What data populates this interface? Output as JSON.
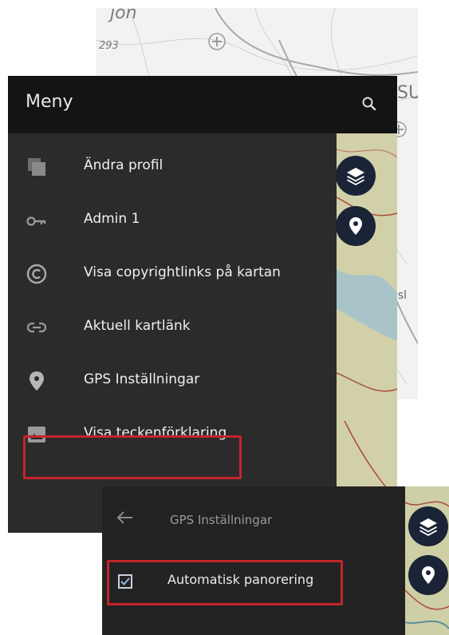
{
  "background_map": {
    "label_top": "jon",
    "label_number": "293",
    "label_right": "SU",
    "label_right2": "dsl"
  },
  "menu": {
    "title": "Meny",
    "items": [
      {
        "label": "Ändra profil",
        "icon": "copy-stack-icon"
      },
      {
        "label": "Admin 1",
        "icon": "key-icon"
      },
      {
        "label": "Visa copyrightlinks på kartan",
        "icon": "copyright-icon"
      },
      {
        "label": "Aktuell kartlänk",
        "icon": "link-icon"
      },
      {
        "label": "GPS Inställningar",
        "icon": "location-pin-icon"
      },
      {
        "label": "Visa teckenförklaring",
        "icon": "image-icon"
      }
    ]
  },
  "gps_settings": {
    "title": "GPS Inställningar",
    "options": [
      {
        "label": "Automatisk panorering",
        "checked": true
      }
    ]
  },
  "colors": {
    "highlight": "#c5242b",
    "fab": "#1b2336",
    "header": "#141414",
    "drawer": "#2b2b2b"
  }
}
